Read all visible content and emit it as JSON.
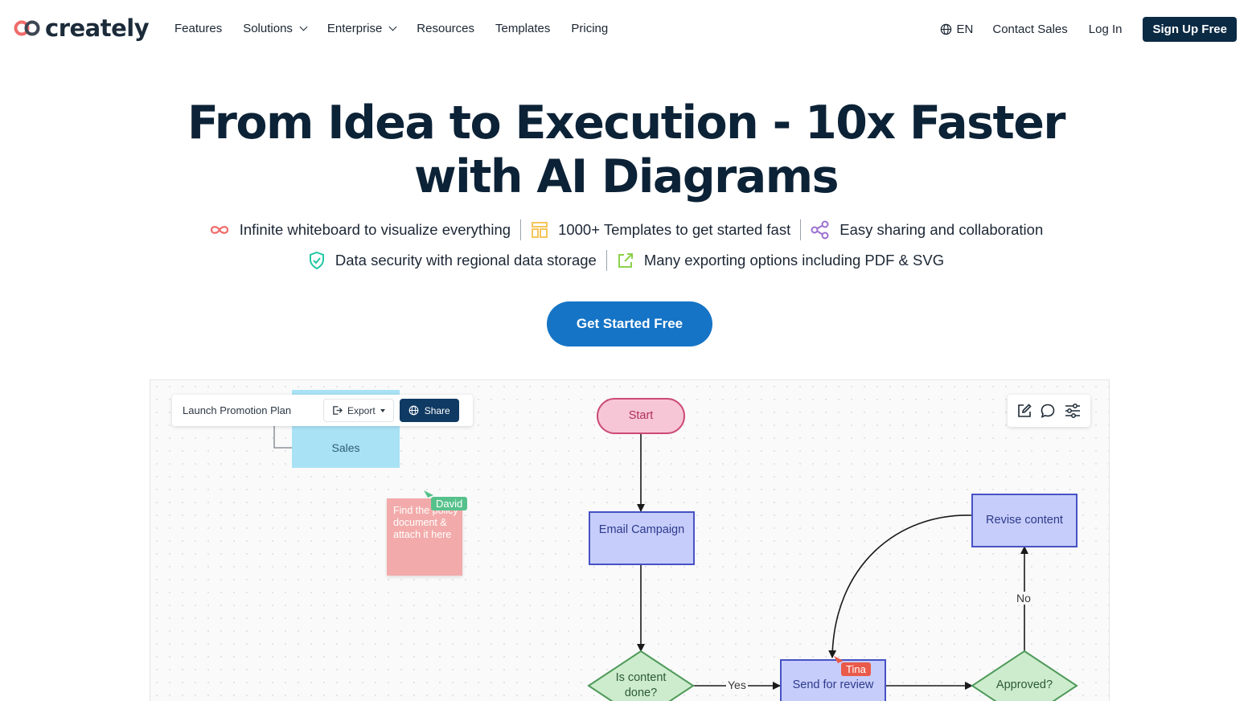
{
  "nav": {
    "logo_text": "creately",
    "links": [
      {
        "label": "Features",
        "has_dropdown": false
      },
      {
        "label": "Solutions",
        "has_dropdown": true
      },
      {
        "label": "Enterprise",
        "has_dropdown": true
      },
      {
        "label": "Resources",
        "has_dropdown": false
      },
      {
        "label": "Templates",
        "has_dropdown": false
      },
      {
        "label": "Pricing",
        "has_dropdown": false
      }
    ],
    "language": "EN",
    "contact_sales": "Contact Sales",
    "login": "Log In",
    "signup": "Sign Up Free"
  },
  "hero": {
    "title_line1": "From Idea to Execution - 10x Faster",
    "title_line2": "with AI Diagrams",
    "features": [
      {
        "icon": "infinity-icon",
        "text": "Infinite whiteboard to visualize everything",
        "color": "#f06b6b"
      },
      {
        "icon": "templates-icon",
        "text": "1000+ Templates to get started fast",
        "color": "#f5c04a"
      },
      {
        "icon": "share-nodes-icon",
        "text": "Easy sharing and collaboration",
        "color": "#9b6fd1"
      },
      {
        "icon": "shield-check-icon",
        "text": "Data security with regional data storage",
        "color": "#22c7a4"
      },
      {
        "icon": "export-icon",
        "text": "Many exporting options including PDF & SVG",
        "color": "#8bd14a"
      }
    ],
    "cta": "Get Started Free"
  },
  "canvas": {
    "doc_title": "Launch Promotion Plan",
    "export_label": "Export",
    "share_label": "Share",
    "right_tools": [
      "edit-icon",
      "comment-icon",
      "settings-sliders-icon"
    ],
    "sales_label": "Sales",
    "sticky_note": "Find the policy document & attach it here",
    "collaborators": [
      "David",
      "Tina"
    ],
    "flow": {
      "start": "Start",
      "email": "Email Campaign",
      "done": "Is content done?",
      "review": "Send for review",
      "approved": "Approved?",
      "revise": "Revise content",
      "yes": "Yes",
      "no": "No"
    },
    "colors": {
      "start_fill": "#f7c6d6",
      "start_stroke": "#cc4a77",
      "process_fill": "#c6cdfa",
      "process_stroke": "#4752c4",
      "decision_fill": "#cdeccd",
      "decision_stroke": "#4f9a5a"
    }
  },
  "accent": "#1574c6",
  "brand_dark": "#0b2a44"
}
